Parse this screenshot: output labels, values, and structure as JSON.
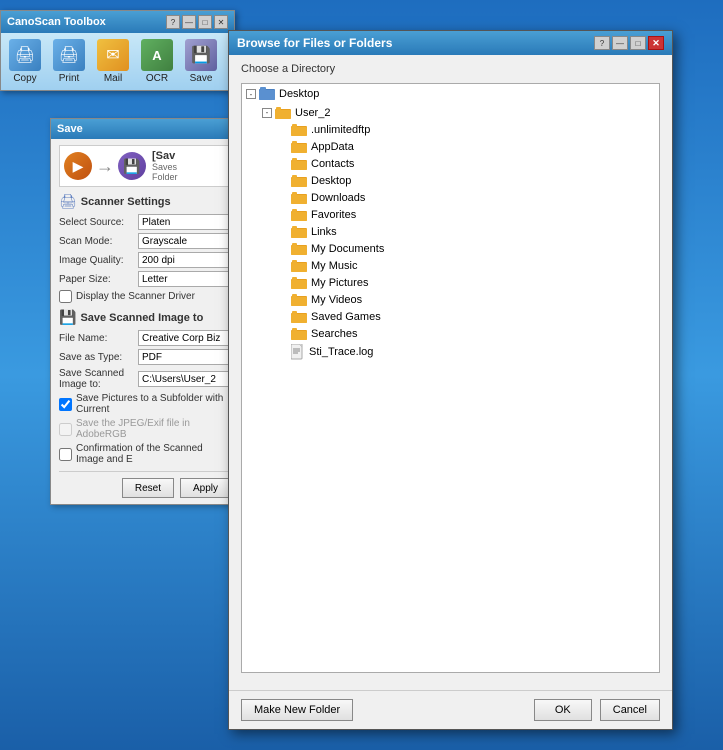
{
  "canoscan": {
    "title": "CanoScan Toolbox",
    "tools": [
      {
        "id": "copy",
        "label": "Copy",
        "icon": "🖨"
      },
      {
        "id": "print",
        "label": "Print",
        "icon": "🖨"
      },
      {
        "id": "mail",
        "label": "Mail",
        "icon": "✉"
      },
      {
        "id": "ocr",
        "label": "OCR",
        "icon": "A"
      },
      {
        "id": "save",
        "label": "Save",
        "icon": "💾"
      }
    ]
  },
  "save_dialog": {
    "title": "Save",
    "scan_action": "[Sav",
    "scan_subtitle_line1": "Saves",
    "scan_subtitle_line2": "Folder",
    "scanner_settings_label": "Scanner Settings",
    "fields": {
      "select_source_label": "Select Source:",
      "select_source_value": "Platen",
      "scan_mode_label": "Scan Mode:",
      "scan_mode_value": "Grayscale",
      "image_quality_label": "Image Quality:",
      "image_quality_value": "200 dpi",
      "paper_size_label": "Paper Size:",
      "paper_size_value": "Letter"
    },
    "display_scanner_driver_label": "Display the Scanner Driver",
    "save_scanned_label": "Save Scanned Image to",
    "file_name_label": "File Name:",
    "file_name_value": "Creative Corp Biz",
    "save_as_type_label": "Save as Type:",
    "save_as_type_value": "PDF",
    "save_scanned_to_label": "Save Scanned Image to:",
    "save_scanned_to_value": "C:\\Users\\User_2",
    "checkbox1_label": "Save Pictures to a Subfolder with Current",
    "checkbox2_label": "Save the JPEG/Exif file in AdobeRGB",
    "checkbox3_label": "Confirmation of the Scanned Image and E",
    "reset_btn": "Reset",
    "apply_btn": "Apply"
  },
  "browse_dialog": {
    "title": "Browse for Files or Folders",
    "instruction": "Choose a Directory",
    "titlebar_btns": [
      "?",
      "—",
      "□",
      "✕"
    ],
    "tree": {
      "desktop": {
        "label": "Desktop",
        "expanded": true,
        "children": [
          {
            "label": "User_2",
            "expanded": true,
            "children": [
              {
                "label": ".unlimitedftp",
                "type": "folder"
              },
              {
                "label": "AppData",
                "type": "folder"
              },
              {
                "label": "Contacts",
                "type": "folder"
              },
              {
                "label": "Desktop",
                "type": "folder"
              },
              {
                "label": "Downloads",
                "type": "folder"
              },
              {
                "label": "Favorites",
                "type": "folder"
              },
              {
                "label": "Links",
                "type": "folder"
              },
              {
                "label": "My Documents",
                "type": "folder"
              },
              {
                "label": "My Music",
                "type": "folder"
              },
              {
                "label": "My Pictures",
                "type": "folder"
              },
              {
                "label": "My Videos",
                "type": "folder"
              },
              {
                "label": "Saved Games",
                "type": "folder"
              },
              {
                "label": "Searches",
                "type": "folder"
              },
              {
                "label": "Sti_Trace.log",
                "type": "file"
              }
            ]
          }
        ]
      }
    },
    "make_folder_btn": "Make New Folder",
    "ok_btn": "OK",
    "cancel_btn": "Cancel"
  }
}
